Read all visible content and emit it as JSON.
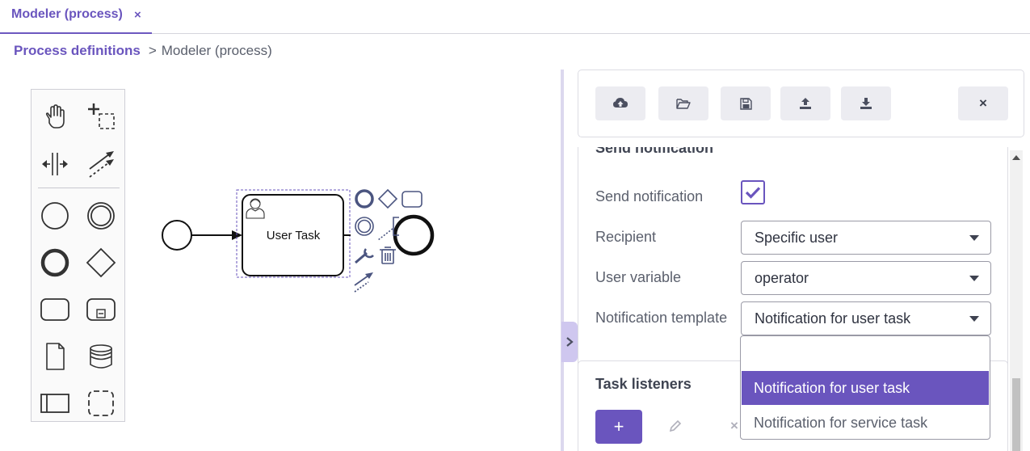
{
  "tab": {
    "label": "Modeler (process)",
    "close": "×"
  },
  "breadcrumb": {
    "link": "Process definitions",
    "separator": ">",
    "current": "Modeler (process)"
  },
  "palette": {
    "tools": [
      "hand-tool",
      "lasso-tool",
      "space-tool",
      "global-connect-tool",
      "start-event",
      "intermediate-event",
      "end-event",
      "gateway",
      "task",
      "subprocess",
      "data-object",
      "data-store",
      "participant",
      "group"
    ]
  },
  "diagram": {
    "task_label": "User Task"
  },
  "toolbar": {
    "buttons": [
      "cloud-upload-icon",
      "folder-open-icon",
      "save-icon",
      "upload-icon",
      "download-icon",
      "close-icon"
    ],
    "close_label": "×"
  },
  "section": {
    "title": "Send notification",
    "send_notification": {
      "label": "Send notification",
      "checked": true
    },
    "recipient": {
      "label": "Recipient",
      "value": "Specific user"
    },
    "user_variable": {
      "label": "User variable",
      "value": "operator"
    },
    "template": {
      "label": "Notification template",
      "value": "Notification for user task"
    }
  },
  "listeners": {
    "title": "Task listeners",
    "add_label": "+",
    "delete_label": "×"
  },
  "dropdown": {
    "options": [
      "",
      "Notification for user task",
      "Notification for service task"
    ],
    "selected": "Notification for user task"
  },
  "colors": {
    "accent": "#6a55be",
    "selection": "#6a55be"
  }
}
